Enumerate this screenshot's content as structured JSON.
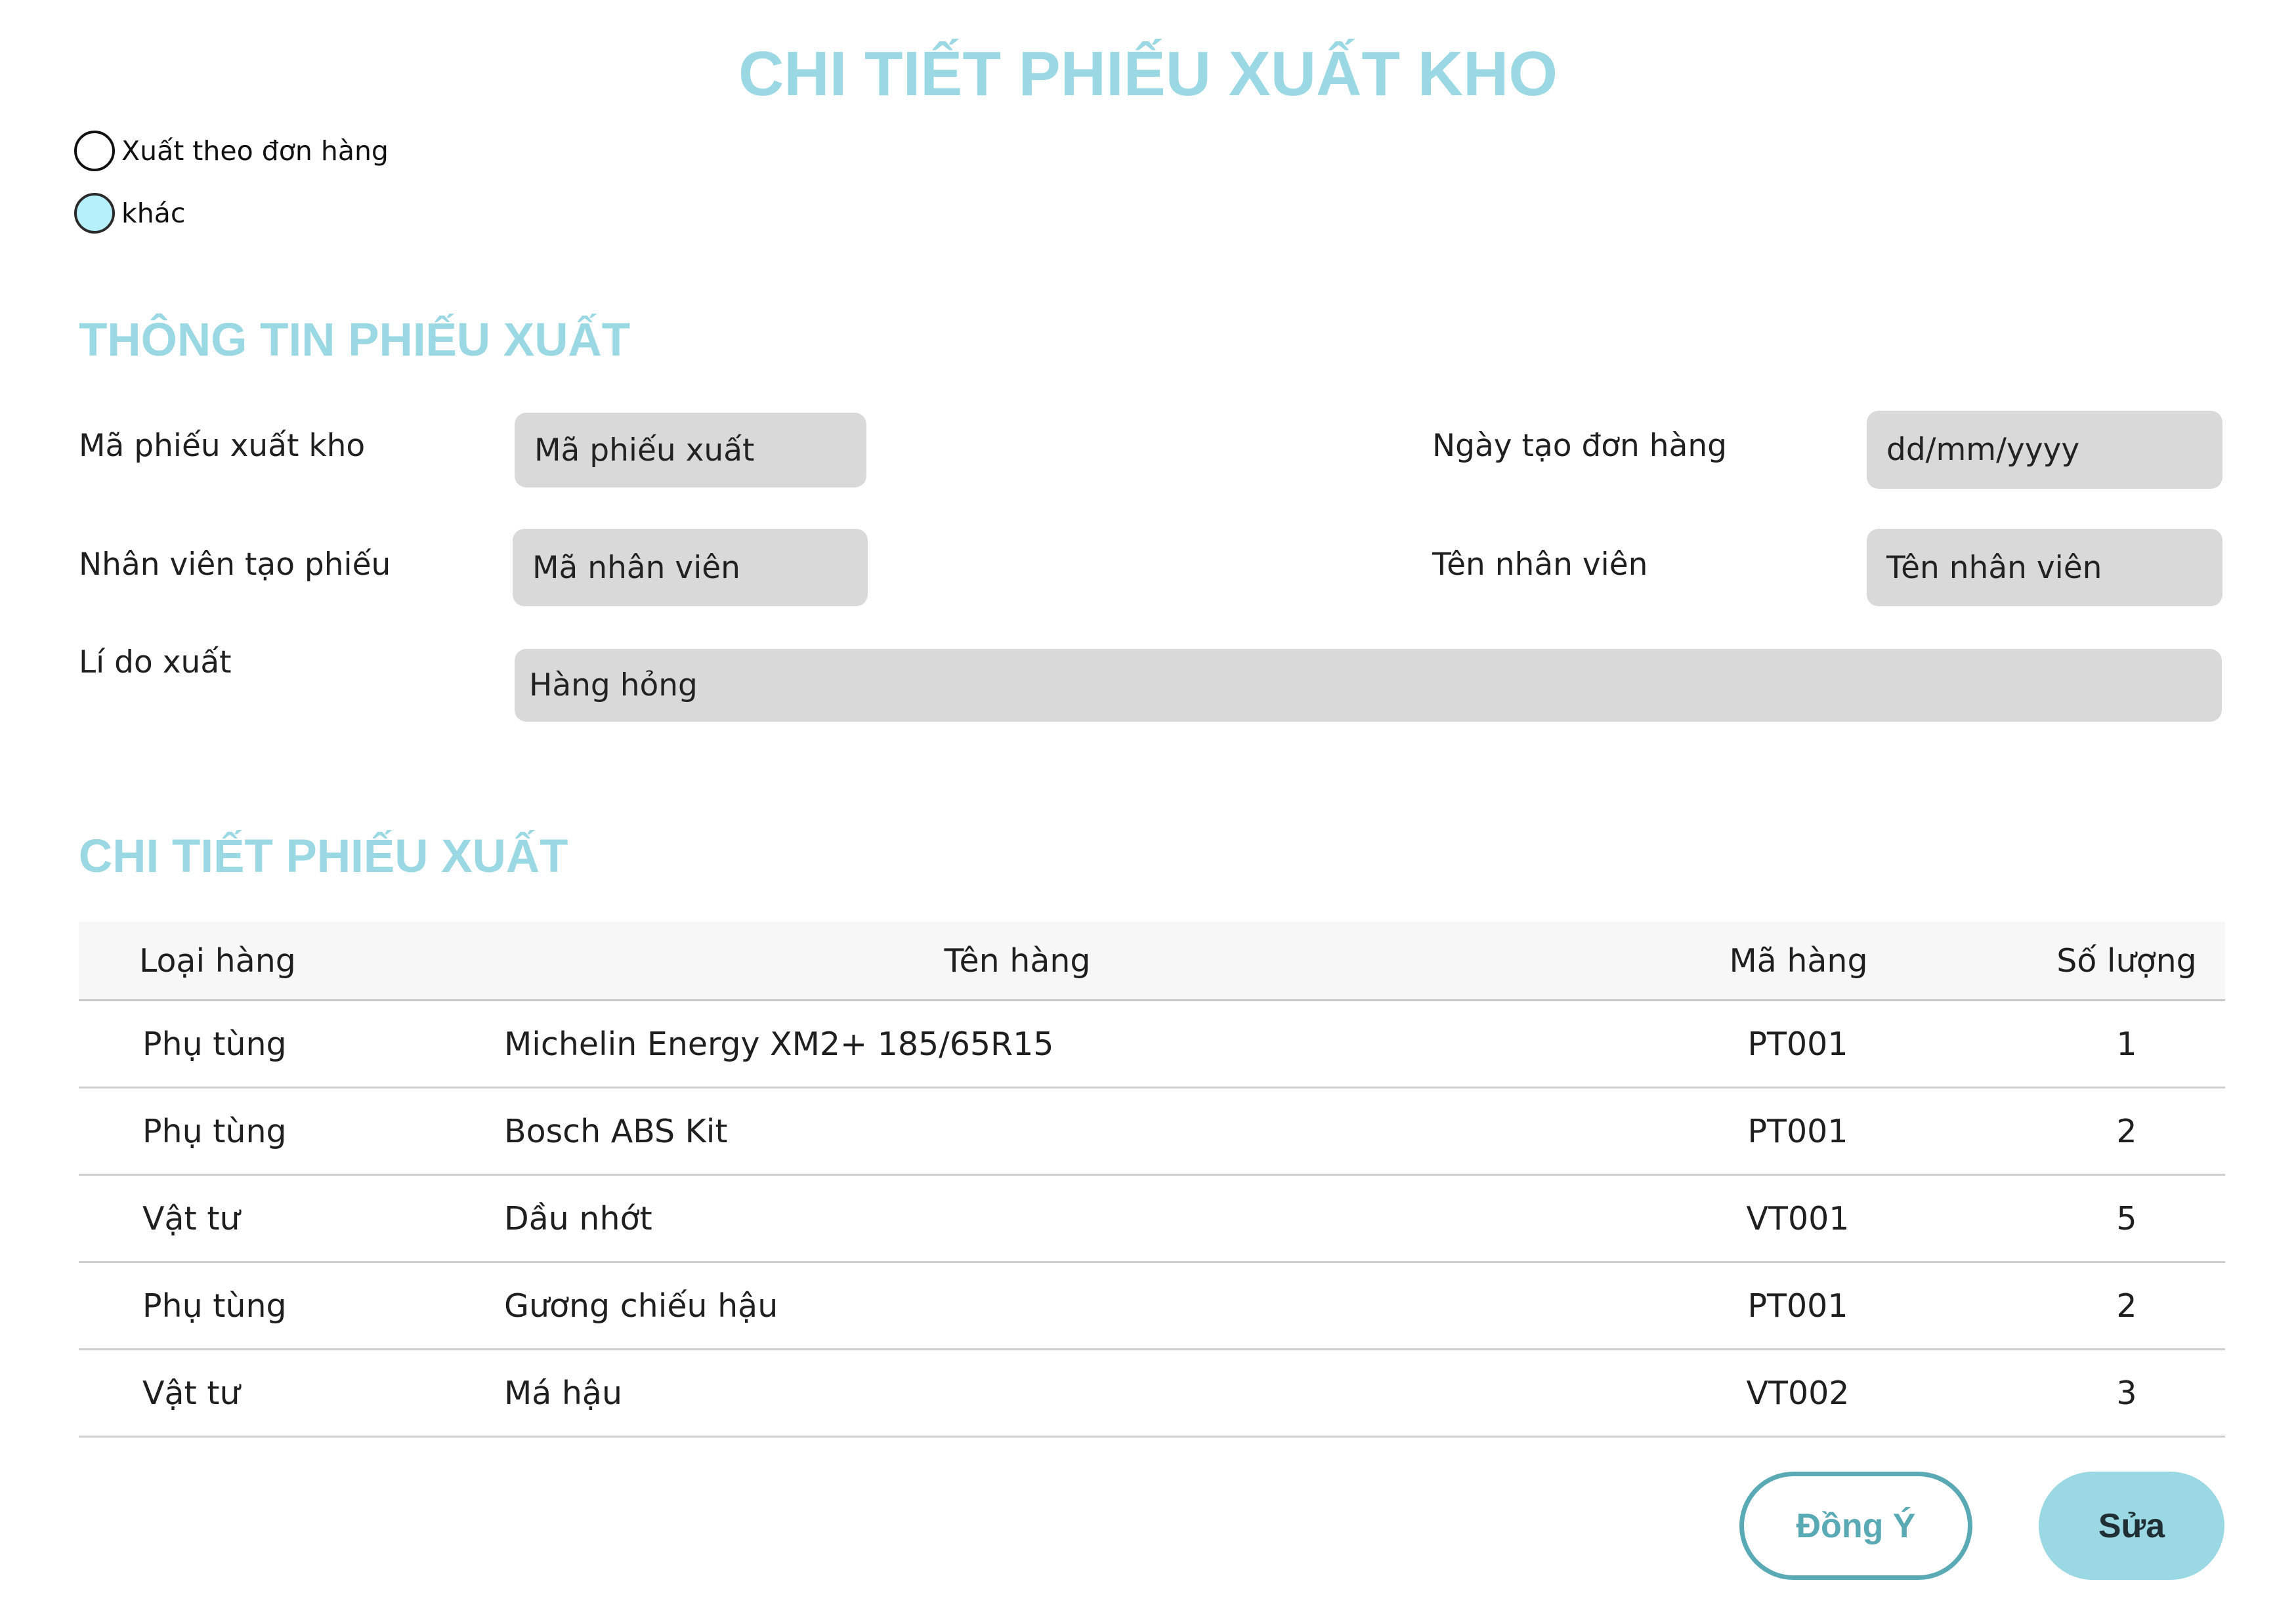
{
  "page": {
    "title": "CHI TIẾT PHIẾU XUẤT KHO"
  },
  "export_type": {
    "options": [
      {
        "label": "Xuất theo đơn hàng",
        "selected": false
      },
      {
        "label": "khác",
        "selected": true
      }
    ]
  },
  "info_section": {
    "title": "THÔNG TIN PHIẾU XUẤT",
    "receipt_code_label": "Mã phiếu xuất kho",
    "receipt_code_placeholder": "Mã phiếu xuất",
    "order_date_label": "Ngày tạo đơn hàng",
    "order_date_placeholder": "dd/mm/yyyy",
    "creator_label": "Nhân viên tạo phiếu",
    "creator_placeholder": "Mã nhân viên",
    "employee_name_label": "Tên nhân viên",
    "employee_name_placeholder": "Tên nhân viên",
    "reason_label": "Lí do xuất",
    "reason_value": "Hàng hỏng"
  },
  "detail_section": {
    "title": "CHI TIẾT PHIẾU XUẤT",
    "columns": [
      "Loại hàng",
      "Tên hàng",
      "Mã hàng",
      "Số lượng"
    ],
    "rows": [
      [
        "Phụ tùng",
        "Michelin Energy XM2+ 185/65R15",
        "PT001",
        "1"
      ],
      [
        "Phụ tùng",
        "Bosch ABS Kit",
        "PT001",
        "2"
      ],
      [
        "Vật tư",
        "Dầu nhớt",
        "VT001",
        "5"
      ],
      [
        "Phụ tùng",
        "Gương chiếu hậu",
        "PT001",
        "2"
      ],
      [
        "Vật tư",
        "Má hậu",
        "VT002",
        "3"
      ]
    ]
  },
  "actions": {
    "agree_label": "Đồng Ý",
    "edit_label": "Sửa"
  },
  "colors": {
    "accent": "#9ad8e4",
    "accent_dark": "#5aaab6",
    "input_bg": "#d9d9d9",
    "radio_selected": "#b6f1fb"
  }
}
